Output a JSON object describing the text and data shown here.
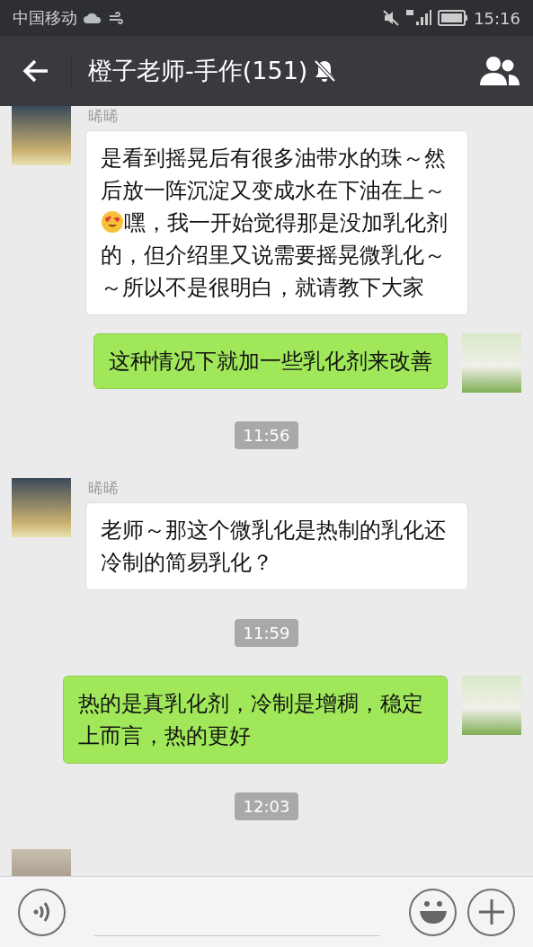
{
  "status_bar": {
    "carrier": "中国移动",
    "time": "15:16"
  },
  "header": {
    "title": "橙子老师-手作(151)",
    "muted": true
  },
  "messages": [
    {
      "kind": "in",
      "sender": "晞晞",
      "parts": [
        {
          "kind": "text",
          "text": "是看到摇晃后有很多油带水的珠～然后放一阵沉淀又变成水在下油在上～"
        },
        {
          "kind": "emoji"
        },
        {
          "kind": "text",
          "text": "嘿，我一开始觉得那是没加乳化剂的，但介绍里又说需要摇晃微乳化～～所以不是很明白，就请教下大家"
        }
      ]
    },
    {
      "kind": "out",
      "parts": [
        {
          "kind": "text",
          "text": "这种情况下就加一些乳化剂来改善"
        }
      ]
    },
    {
      "kind": "time",
      "text": "11:56"
    },
    {
      "kind": "in",
      "sender": "晞晞",
      "parts": [
        {
          "kind": "text",
          "text": "老师～那这个微乳化是热制的乳化还冷制的简易乳化？"
        }
      ]
    },
    {
      "kind": "time",
      "text": "11:59"
    },
    {
      "kind": "out",
      "parts": [
        {
          "kind": "text",
          "text": "热的是真乳化剂，冷制是增稠，稳定上而言，热的更好"
        }
      ]
    },
    {
      "kind": "time",
      "text": "12:03"
    },
    {
      "kind": "in_partial"
    }
  ]
}
